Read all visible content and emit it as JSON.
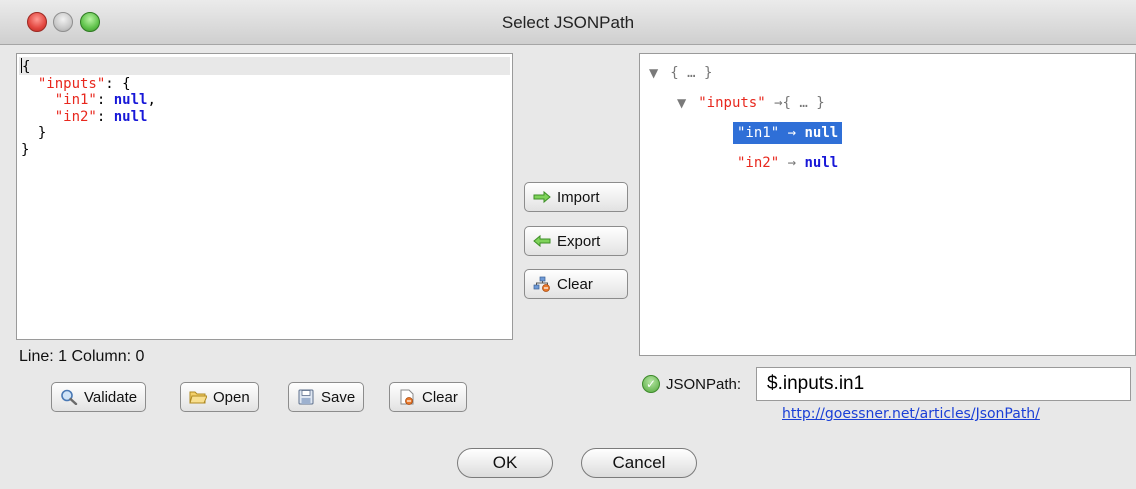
{
  "window": {
    "title": "Select JSONPath"
  },
  "editor": {
    "lines": [
      "{",
      "\"inputs\"",
      "\"in1\"",
      "null",
      "\"in2\"",
      "null",
      "}",
      "}"
    ]
  },
  "status": {
    "text": "Line: 1 Column: 0"
  },
  "left_buttons": {
    "validate": "Validate",
    "open": "Open",
    "save": "Save",
    "clear": "Clear"
  },
  "middle_buttons": {
    "import": "Import",
    "export": "Export",
    "clear": "Clear"
  },
  "tree": {
    "root_label": "{ … }",
    "inputs_key": "\"inputs\"",
    "inputs_value": "{ … }",
    "in1_key": "\"in1\"",
    "in1_value": "null",
    "in2_key": "\"in2\"",
    "in2_value": "null",
    "arrow": "→"
  },
  "jsonpath": {
    "label": "JSONPath:",
    "value": "$.inputs.in1"
  },
  "link": "http://goessner.net/articles/JsonPath/",
  "dialog_buttons": {
    "ok": "OK",
    "cancel": "Cancel"
  },
  "colors": {
    "key": "#e8281e",
    "null": "#1818d8",
    "selection": "#2f6fd7",
    "link": "#1a3fd6"
  }
}
